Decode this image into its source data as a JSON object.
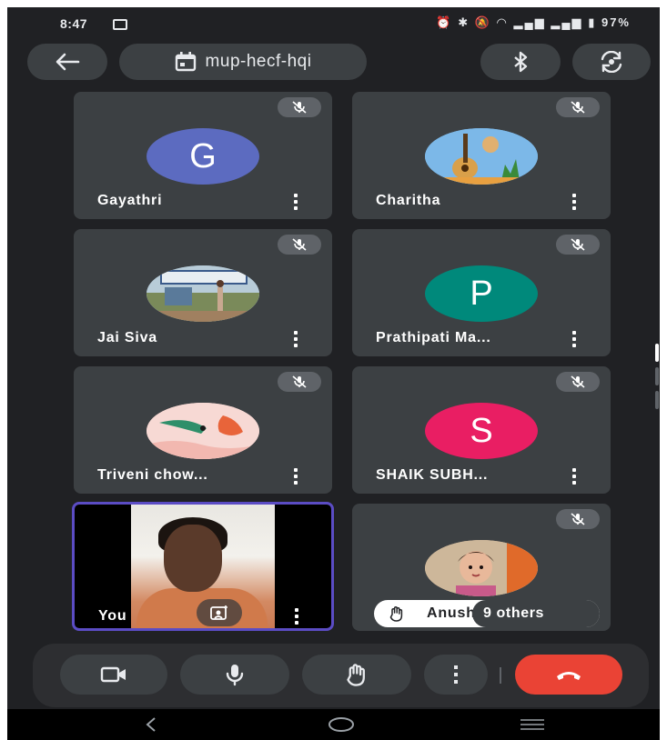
{
  "status_bar": {
    "time": "8:47",
    "battery": "97%"
  },
  "top_bar": {
    "meeting_code": "mup-hecf-hqi"
  },
  "participants": [
    {
      "name": "Gayathri",
      "initial": "G",
      "avatar_color": "#5c6bc0"
    },
    {
      "name": "Charitha",
      "initial": "",
      "avatar_color": "#7cb8e8"
    },
    {
      "name": "Jai Siva",
      "initial": "",
      "avatar_color": "#8aa2b8"
    },
    {
      "name": "Prathipati Ma...",
      "initial": "P",
      "avatar_color": "#00897b"
    },
    {
      "name": "Triveni chow...",
      "initial": "",
      "avatar_color": "#f4c7c3"
    },
    {
      "name": "SHAIK SUBH...",
      "initial": "S",
      "avatar_color": "#e91e63"
    }
  ],
  "self_tile": {
    "name": "You",
    "border_color": "#5b4cc4"
  },
  "others_tile": {
    "first_name": "Anush",
    "count_label": "9 others"
  },
  "colors": {
    "background": "#202124",
    "tile": "#3c4043",
    "hangup": "#ea4335"
  }
}
